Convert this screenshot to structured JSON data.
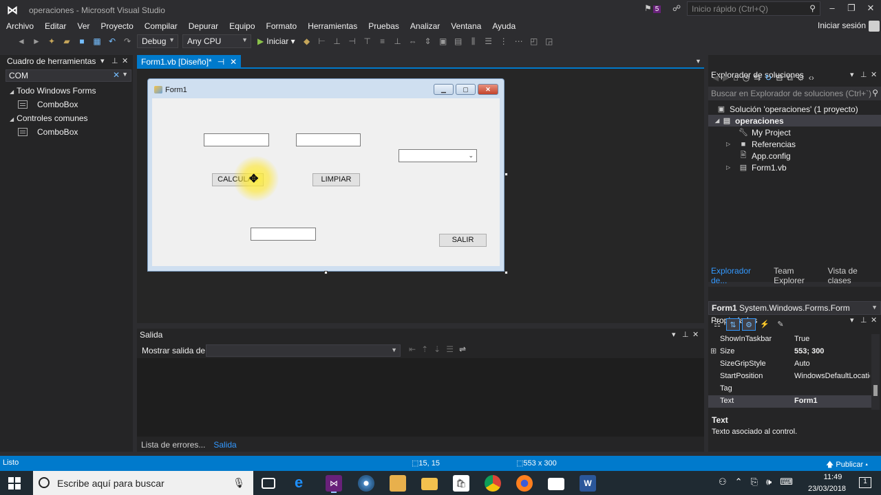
{
  "window": {
    "title": "operaciones - Microsoft Visual Studio",
    "notification_count": "5",
    "quick_launch_placeholder": "Inicio rápido (Ctrl+Q)",
    "signin": "Iniciar sesión"
  },
  "menu": [
    "Archivo",
    "Editar",
    "Ver",
    "Proyecto",
    "Compilar",
    "Depurar",
    "Equipo",
    "Formato",
    "Herramientas",
    "Pruebas",
    "Analizar",
    "Ventana",
    "Ayuda"
  ],
  "toolbar": {
    "config": "Debug",
    "platform": "Any CPU",
    "start_label": "Iniciar"
  },
  "toolbox": {
    "title": "Cuadro de herramientas",
    "search_value": "COM",
    "groups": [
      {
        "label": "Todo Windows Forms",
        "items": [
          "ComboBox"
        ]
      },
      {
        "label": "Controles comunes",
        "items": [
          "ComboBox"
        ]
      }
    ]
  },
  "doc_tab": {
    "label": "Form1.vb [Diseño]*"
  },
  "form": {
    "title": "Form1",
    "buttons": {
      "calcular": "CALCULAR",
      "limpiar": "LIMPIAR",
      "salir": "SALIR"
    }
  },
  "output": {
    "title": "Salida",
    "show_from_label": "Mostrar salida de:",
    "tabs": [
      "Lista de errores...",
      "Salida"
    ],
    "selected_tab": "Salida"
  },
  "solution_explorer": {
    "title": "Explorador de soluciones",
    "search_placeholder": "Buscar en Explorador de soluciones (Ctrl+`)",
    "solution": "Solución 'operaciones'  (1 proyecto)",
    "project": "operaciones",
    "nodes": [
      "My Project",
      "Referencias",
      "App.config",
      "Form1.vb"
    ],
    "tabs": [
      "Explorador de...",
      "Team Explorer",
      "Vista de clases"
    ]
  },
  "properties": {
    "title": "Propiedades",
    "object": "Form1",
    "object_type": "System.Windows.Forms.Form",
    "rows": [
      {
        "name": "ShowInTaskbar",
        "value": "True"
      },
      {
        "name": "Size",
        "value": "553; 300"
      },
      {
        "name": "SizeGripStyle",
        "value": "Auto"
      },
      {
        "name": "StartPosition",
        "value": "WindowsDefaultLocation"
      },
      {
        "name": "Tag",
        "value": ""
      },
      {
        "name": "Text",
        "value": "Form1"
      }
    ],
    "desc_name": "Text",
    "desc_text": "Texto asociado al control."
  },
  "status": {
    "text": "Listo",
    "position": "15, 15",
    "size": "553 x 300",
    "publish": "Publicar"
  },
  "taskbar": {
    "search_placeholder": "Escribe aquí para buscar",
    "time": "11:49",
    "date": "23/03/2018",
    "notify_count": "1"
  }
}
